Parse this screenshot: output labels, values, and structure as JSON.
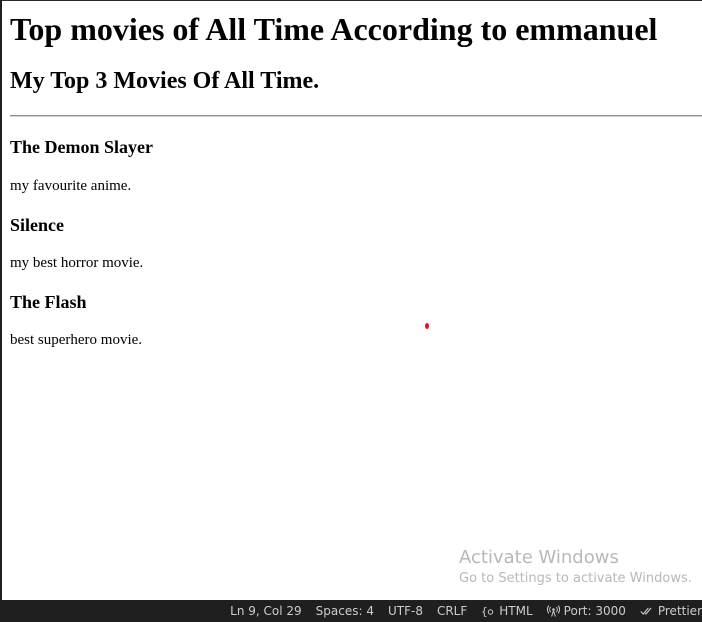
{
  "page": {
    "title": "Top movies of All Time According to emmanuel",
    "subtitle": "My Top 3 Movies Of All Time."
  },
  "movies": [
    {
      "title": "The Demon Slayer",
      "description": "my favourite anime."
    },
    {
      "title": "Silence",
      "description": "my best horror movie."
    },
    {
      "title": "The Flash",
      "description": "best superhero movie."
    }
  ],
  "watermark": {
    "title": "Activate Windows",
    "subtitle": "Go to Settings to activate Windows."
  },
  "statusbar": {
    "cursor_position": "Ln 9, Col 29",
    "indentation": "Spaces: 4",
    "encoding": "UTF-8",
    "line_endings": "CRLF",
    "language": "HTML",
    "language_icon": "braces-icon",
    "live_server": "Port: 3000",
    "live_server_icon": "broadcast-icon",
    "formatter": "Prettier",
    "formatter_icon": "double-check-icon"
  },
  "colors": {
    "statusbar_bg": "#1f1f1f",
    "statusbar_text": "#cccccc",
    "cursor_dot": "#e81123",
    "watermark_text": "#b8b8b8"
  }
}
